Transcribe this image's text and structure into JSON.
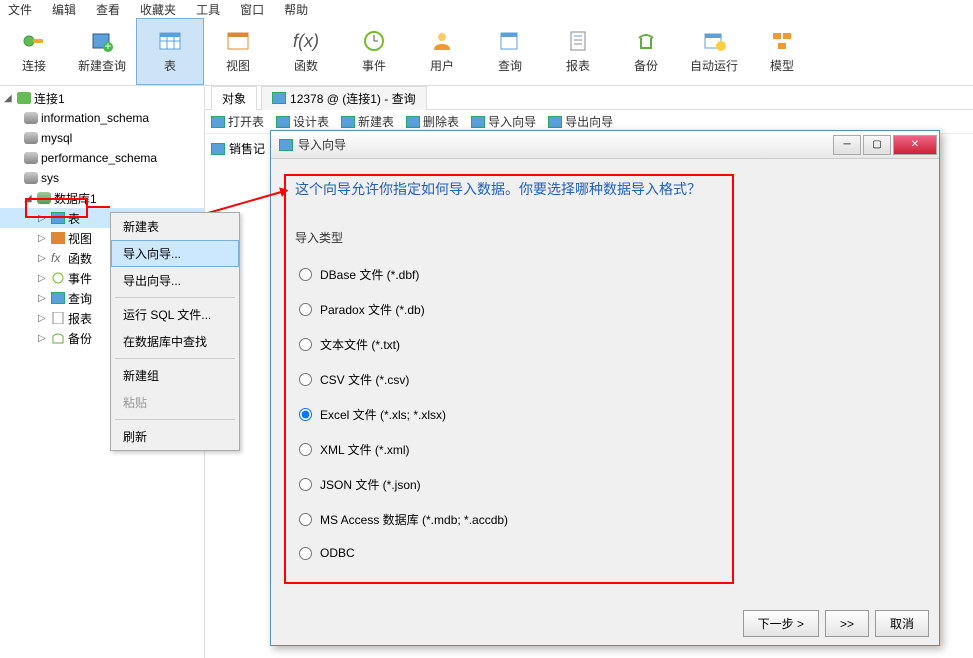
{
  "menu": [
    "文件",
    "编辑",
    "查看",
    "收藏夹",
    "工具",
    "窗口",
    "帮助"
  ],
  "toolbar": [
    {
      "label": "连接",
      "icon": "plug"
    },
    {
      "label": "新建查询",
      "icon": "plus-grid"
    },
    {
      "label": "表",
      "icon": "grid",
      "active": true
    },
    {
      "label": "视图",
      "icon": "view"
    },
    {
      "label": "函数",
      "icon": "fx"
    },
    {
      "label": "事件",
      "icon": "clock"
    },
    {
      "label": "用户",
      "icon": "user"
    },
    {
      "label": "查询",
      "icon": "query"
    },
    {
      "label": "报表",
      "icon": "report"
    },
    {
      "label": "备份",
      "icon": "backup"
    },
    {
      "label": "自动运行",
      "icon": "auto"
    },
    {
      "label": "模型",
      "icon": "model"
    }
  ],
  "tree": {
    "conn": "连接1",
    "schemas": [
      "information_schema",
      "mysql",
      "performance_schema",
      "sys"
    ],
    "db": "数据库1",
    "children": [
      "表",
      "视图",
      "函数",
      "事件",
      "查询",
      "报表",
      "备份"
    ]
  },
  "tabs": {
    "obj": "对象",
    "query": "12378 @ (连接1) - 查询"
  },
  "subtools": [
    "打开表",
    "设计表",
    "新建表",
    "删除表",
    "导入向导",
    "导出向导"
  ],
  "sales_tab": "销售记",
  "context_menu": {
    "new_table": "新建表",
    "import_wizard": "导入向导...",
    "export_wizard": "导出向导...",
    "run_sql": "运行 SQL 文件...",
    "find_in_db": "在数据库中查找",
    "new_group": "新建组",
    "paste": "粘贴",
    "refresh": "刷新"
  },
  "dialog": {
    "title": "导入向导",
    "heading": "这个向导允许你指定如何导入数据。你要选择哪种数据导入格式？",
    "type_label": "导入类型",
    "options": [
      "DBase 文件 (*.dbf)",
      "Paradox 文件 (*.db)",
      "文本文件 (*.txt)",
      "CSV 文件 (*.csv)",
      "Excel 文件 (*.xls; *.xlsx)",
      "XML 文件 (*.xml)",
      "JSON 文件 (*.json)",
      "MS Access 数据库 (*.mdb; *.accdb)",
      "ODBC"
    ],
    "selected_index": 4,
    "next_btn": "下一步 >",
    "skip_btn": ">>",
    "cancel_btn": "取消"
  }
}
